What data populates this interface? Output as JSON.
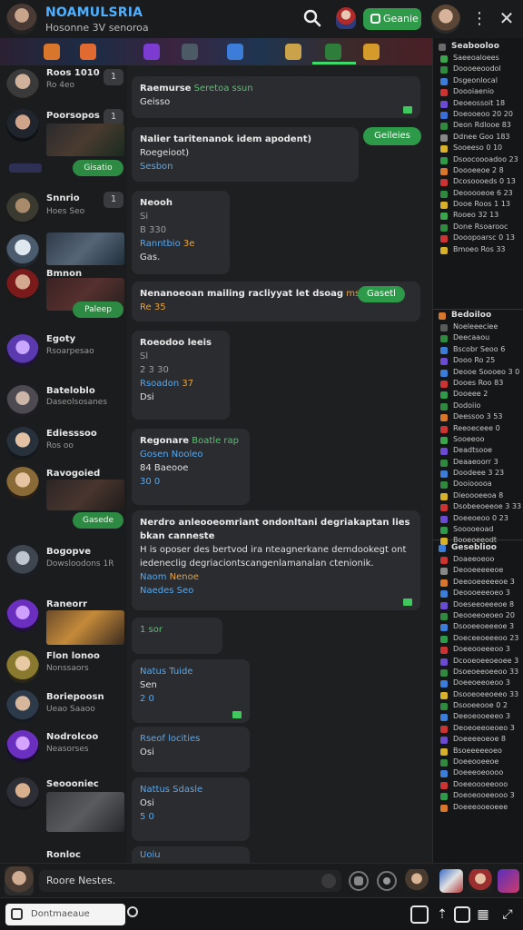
{
  "header": {
    "title": "NOAMULSRIA",
    "subtitle": "Hosonne 3V senoroa",
    "action_button": "Geanie"
  },
  "banner": {
    "icons": [
      {
        "name": "fire-icon",
        "color": "#d8762b"
      },
      {
        "name": "flame-icon",
        "color": "#e06a2f"
      },
      {
        "name": "game-icon",
        "color": "#7c3bd1"
      },
      {
        "name": "sword-icon",
        "color": "#4c5a66"
      },
      {
        "name": "shield-icon",
        "color": "#3b7dd8"
      },
      {
        "name": "scroll-icon",
        "color": "#c9a24a"
      },
      {
        "name": "star-icon",
        "color": "#2f7d3a"
      },
      {
        "name": "chest-icon",
        "color": "#d49a2a"
      }
    ]
  },
  "leftlist": {
    "rows": [
      {
        "name": "Roos 1010",
        "sub": "Ro 4eo",
        "count": "1"
      },
      {
        "name": "Poorsopos",
        "sub": "",
        "count": "1",
        "button": "Gisatio"
      },
      {
        "name": "Snnrio",
        "sub": "Hoes Seo",
        "count": "1"
      },
      {
        "name": "",
        "sub": "",
        "count": ""
      },
      {
        "name": "Bmnon",
        "sub": "",
        "count": "",
        "button": "Paleep"
      },
      {
        "name": "Egoty",
        "sub": "Rsoarpesao",
        "count": ""
      },
      {
        "name": "Bateloblo",
        "sub": "Daseolsosanes",
        "count": ""
      },
      {
        "name": "Ediesssoo",
        "sub": "Ros oo",
        "count": ""
      },
      {
        "name": "Ravogoied",
        "sub": "",
        "count": "",
        "button": "Gasede"
      },
      {
        "name": "Bogopve",
        "sub": "Dowsloodons 1R",
        "count": ""
      },
      {
        "name": "Raneorr",
        "sub": "",
        "count": ""
      },
      {
        "name": "Flon lonoo",
        "sub": "Nonssaors",
        "count": ""
      },
      {
        "name": "Boriepoosn",
        "sub": "Ueao Saaoo",
        "count": ""
      },
      {
        "name": "Nodrolcoo",
        "sub": "Neasorses",
        "count": ""
      },
      {
        "name": "Seoooniec",
        "sub": "",
        "count": ""
      },
      {
        "name": "Ronloc",
        "sub": "",
        "count": ""
      }
    ]
  },
  "chat": {
    "messages": [
      {
        "title": "Raemurse",
        "tag": "Seretoa ssun",
        "body": "Geisso"
      },
      {
        "title": "Nalier taritenanok idem apodent)",
        "body": "Roegeioot)",
        "link": "Sesbon",
        "pill": "Geileies"
      },
      {
        "title": "Neooh",
        "l1": "Si",
        "l2": "B 330",
        "link": "Ranntbio",
        "tag": "3e",
        "foot": "Gas."
      },
      {
        "title": "Nenanoeoan mailing racliyyat let dsoag",
        "badge": "ms 10",
        "pill": "Gasetl",
        "foot": "Re 35"
      },
      {
        "title": "Roeodoo leeis",
        "l1": "Sl",
        "l2": "2 3 30",
        "link": "Rsoadon",
        "tag": "37",
        "foot": "Dsi"
      },
      {
        "title": "Regonare",
        "tag": "Boatle rap",
        "link": "Gosen Nooleo",
        "body": "84 Baeooe",
        "foot": "30 0"
      },
      {
        "title": "Nerdro anleooeomriant ondonltani degriakaptan lies bkan canneste",
        "body": "H is oposer des bertvod ira nteagnerkane demdookegt ont iedeneclig degriaciontscangenlamanalan ctenionik.",
        "link": "Naom",
        "tag": "Nenoe",
        "foot": "Naedes Seo"
      },
      {
        "title": "1 sor"
      },
      {
        "title": "Natus Tuide",
        "body": "Sen",
        "foot": "2 0"
      },
      {
        "title": "Rseof locities",
        "body": "Osi"
      },
      {
        "title": "Nattus Sdasle",
        "body": "Osi",
        "foot": "5 0"
      },
      {
        "title": "Uoiu"
      }
    ]
  },
  "rightpanel": {
    "sections": [
      {
        "title": "Seabooloo",
        "color": "#6a6a6a",
        "items": [
          "Saeeoaloees",
          "Doooeeoodol",
          "Dsgeonlocal",
          "Doooiaenio",
          "Deoeossoit 18",
          "Doeooeoo 20 20",
          "Deon Rdlooe 83",
          "Ddnee Goo 183",
          "Sooeeso 0 10",
          "Dsoocoooadoo 23",
          "Doooeeoe 2 8",
          "Dcosoooeds 0 13",
          "Deooooeoe 6 23",
          "Dooe Roos 1 13",
          "Rooeo 32 13",
          "Done Rsoarooc",
          "Dooopoarsc 0 13",
          "Bmoeo Ros 33"
        ],
        "colors": [
          "#3aa54a",
          "#2f8a3f",
          "#3b7dd8",
          "#cc3333",
          "#6a4bd1",
          "#3b6fd8",
          "#2f8a3f",
          "#888888",
          "#d8b12b",
          "#2f9a49",
          "#d8762b",
          "#cc3333",
          "#2f8a3f",
          "#d8b12b",
          "#3aa54a",
          "#2f8a3f",
          "#cc3333",
          "#d8b12b"
        ]
      },
      {
        "title": "Bedoiloo",
        "color": "#d8762b",
        "items": [
          "Noeleeeciee",
          "Deecaaou",
          "Bscobr Seoo 6",
          "Dooo Ro 25",
          "Deooe Soooeo 3 0",
          "Dooes Roo 83",
          "Dooeee 2",
          "Dodoiio",
          "Deessoo 3 53",
          "Reeoeceee 0",
          "Sooeeoo",
          "Deadtsooe",
          "Deaaeoorr 3",
          "Doodeee 3 23",
          "Dooiooooa",
          "Dieoooeeoa 8",
          "Dsobeeoeeoe 3 33",
          "Doeeoeoo 0 23",
          "Sooooeoad",
          "Booeoeeodt"
        ],
        "colors": [
          "#5a5a5a",
          "#2f8a3f",
          "#3b7dd8",
          "#6a4bd1",
          "#3b7dd8",
          "#cc3333",
          "#2f9a49",
          "#2f8a3f",
          "#d8762b",
          "#cc3333",
          "#3aa54a",
          "#6a4bd1",
          "#2f8a3f",
          "#3b7dd8",
          "#2f8a3f",
          "#d8b12b",
          "#cc3333",
          "#6a4bd1",
          "#2f9a49",
          "#d8b12b"
        ]
      },
      {
        "title": "Geseblioo",
        "color": "#3b7dd8",
        "items": [
          "Doaeeoeoo",
          "Deooeeeeeoe",
          "Deeooeeeeeoe 3",
          "Deoooeeeoeo 3",
          "Doeseeoeeeoe 8",
          "Deooeeoeoeo 20",
          "Dsooeeoeeeoe 3",
          "Doeceeoeeeoo 23",
          "Doeeooeeeoo 3",
          "Dcooeoeeoeoee 3",
          "Dsoeoeeoeeoo 33",
          "Doeeoeeoeoo 3",
          "Dsooeoeeoeeo 33",
          "Dsooeeooe 0 2",
          "Deeoeooeeeo 3",
          "Deoeoeeoeoeo 3",
          "Doeeeeoeoe 8",
          "Bsoeeeeeoeo",
          "Doeeooeeoe",
          "Doeeeoeoooo",
          "Doeeoooeeooo",
          "Doeoeooeeooo 3",
          "Doeeeooeoeee"
        ],
        "colors": [
          "#cc3333",
          "#888888",
          "#d8762b",
          "#3b7dd8",
          "#6a4bd1",
          "#2f8a3f",
          "#3b7dd8",
          "#2f9a49",
          "#cc3333",
          "#6a4bd1",
          "#2f8a3f",
          "#3b7dd8",
          "#d8b12b",
          "#2f8a3f",
          "#3b7dd8",
          "#cc3333",
          "#6a4bd1",
          "#d8b12b",
          "#2f8a3f",
          "#3b7dd8",
          "#cc3333",
          "#2f9a49",
          "#d8762b"
        ]
      }
    ]
  },
  "input": {
    "value": "Roore Nestes."
  },
  "bottombar": {
    "placeholder": "Dontmaeaue"
  },
  "colors": {
    "accent_green": "#2f9a49",
    "title_blue": "#4fb0ff",
    "link_blue": "#56a9f0",
    "highlight_orange": "#e9a23b"
  }
}
